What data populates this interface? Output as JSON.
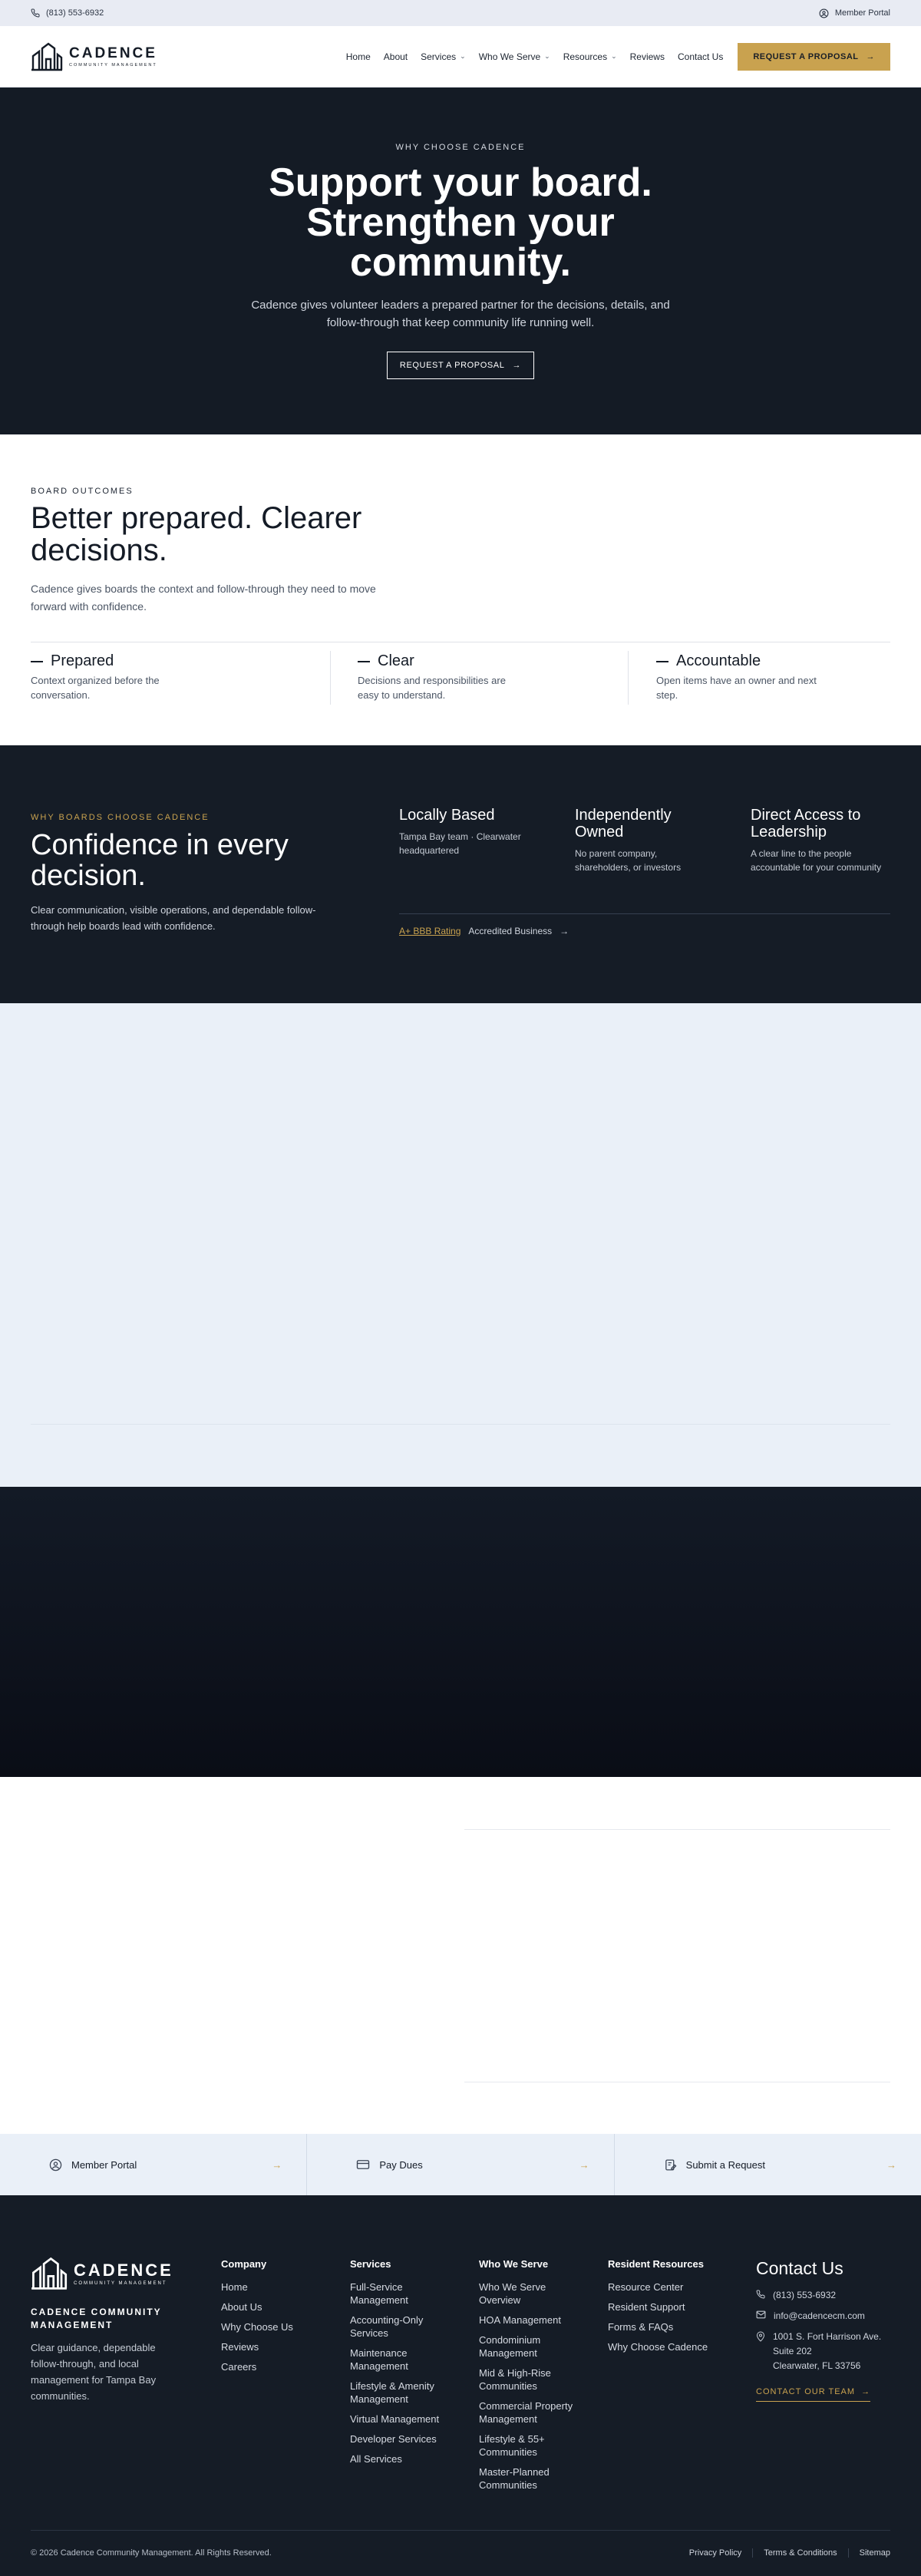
{
  "colors": {
    "navy": "#141b25",
    "gold": "#c9a24f",
    "light": "#eaf0f8"
  },
  "topbar": {
    "phone": "(813) 553-6932",
    "portal": "Member Portal"
  },
  "brand": {
    "name": "CADENCE",
    "tagline": "COMMUNITY MANAGEMENT"
  },
  "nav": {
    "items": [
      "Home",
      "About",
      "Services",
      "Who We Serve",
      "Resources",
      "Reviews",
      "Contact Us"
    ],
    "cta": "REQUEST A PROPOSAL"
  },
  "hero": {
    "eyebrow": "WHY CHOOSE CADENCE",
    "title": "Support your board. Strengthen your community.",
    "subtitle": "Cadence gives volunteer leaders a prepared partner for the decisions, details, and follow-through that keep community life running well.",
    "button": "REQUEST A PROPOSAL"
  },
  "outcomes": {
    "eyebrow": "BOARD OUTCOMES",
    "title": "Better prepared. Clearer decisions.",
    "subtitle": "Cadence gives boards the context and follow-through they need to move forward with confidence.",
    "features": [
      {
        "title": "Prepared",
        "desc": "Context organized before the conversation."
      },
      {
        "title": "Clear",
        "desc": "Decisions and responsibilities are easy to understand."
      },
      {
        "title": "Accountable",
        "desc": "Open items have an owner and next step."
      }
    ]
  },
  "confidence": {
    "eyebrow": "WHY BOARDS CHOOSE CADENCE",
    "title": "Confidence in every decision.",
    "subtitle": "Clear communication, visible operations, and dependable follow-through help boards lead with confidence.",
    "pillars": [
      {
        "title": "Locally Based",
        "desc": "Tampa Bay team · Clearwater headquartered"
      },
      {
        "title": "Independently Owned",
        "desc": "No parent company, shareholders, or investors"
      },
      {
        "title": "Direct Access to Leadership",
        "desc": "A clear line to the people accountable for your community"
      }
    ],
    "bbb_rating": "A+ BBB Rating",
    "bbb_label": "Accredited Business"
  },
  "quick_links": [
    {
      "label": "Member Portal",
      "icon": "user-circle-icon"
    },
    {
      "label": "Pay Dues",
      "icon": "credit-card-icon"
    },
    {
      "label": "Submit a Request",
      "icon": "request-form-icon"
    }
  ],
  "footer": {
    "brand_name": "CADENCE COMMUNITY MANAGEMENT",
    "blurb": "Clear guidance, dependable follow-through, and local management for Tampa Bay communities.",
    "company": {
      "heading": "Company",
      "items": [
        "Home",
        "About Us",
        "Why Choose Us",
        "Reviews",
        "Careers"
      ]
    },
    "services": {
      "heading": "Services",
      "items": [
        "Full-Service Management",
        "Accounting-Only Services",
        "Maintenance Management",
        "Lifestyle & Amenity Management",
        "Virtual Management",
        "Developer Services",
        "All Services"
      ]
    },
    "who_we_serve": {
      "heading": "Who We Serve",
      "items": [
        "Who We Serve Overview",
        "HOA Management",
        "Condominium Management",
        "Mid & High-Rise Communities",
        "Commercial Property Management",
        "Lifestyle & 55+ Communities",
        "Master-Planned Communities"
      ]
    },
    "resources": {
      "heading": "Resident Resources",
      "items": [
        "Resource Center",
        "Resident Support",
        "Forms & FAQs",
        "Why Choose Cadence"
      ]
    },
    "contact": {
      "heading": "Contact Us",
      "phone": "(813) 553-6932",
      "email": "info@cadencecm.com",
      "address1": "1001 S. Fort Harrison Ave.",
      "address2": "Suite 202",
      "address3": "Clearwater, FL 33756",
      "link": "CONTACT OUR TEAM"
    },
    "copyright": "© 2026 Cadence Community Management. All Rights Reserved.",
    "legal": [
      "Privacy Policy",
      "Terms & Conditions",
      "Sitemap"
    ]
  }
}
